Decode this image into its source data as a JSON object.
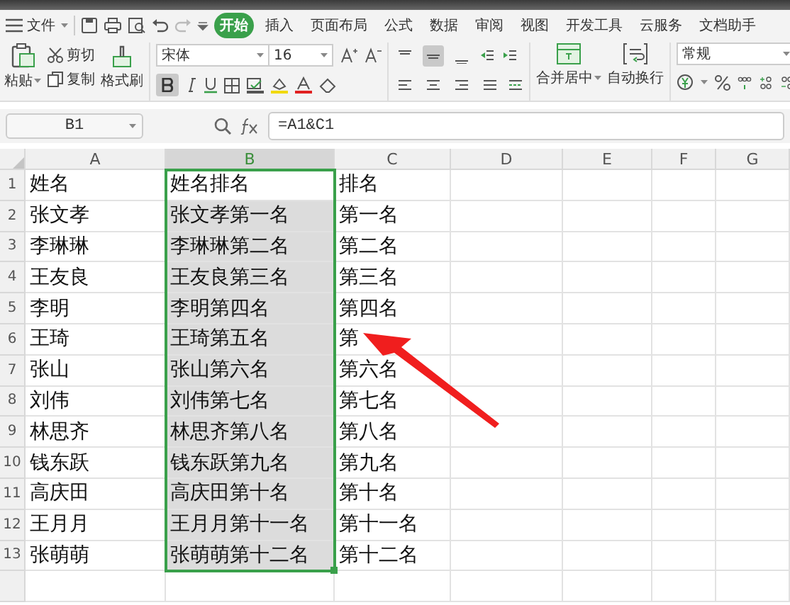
{
  "menu": {
    "file_label": "文件",
    "tabs": [
      {
        "label": "开始",
        "selected": true
      },
      {
        "label": "插入",
        "selected": false
      },
      {
        "label": "页面布局",
        "selected": false
      },
      {
        "label": "公式",
        "selected": false
      },
      {
        "label": "数据",
        "selected": false
      },
      {
        "label": "审阅",
        "selected": false
      },
      {
        "label": "视图",
        "selected": false
      },
      {
        "label": "开发工具",
        "selected": false
      },
      {
        "label": "云服务",
        "selected": false
      },
      {
        "label": "文档助手",
        "selected": false
      }
    ]
  },
  "ribbon": {
    "paste": "粘贴",
    "cut": "剪切",
    "copy": "复制",
    "format_painter": "格式刷",
    "font_name": "宋体",
    "font_size": "16",
    "bold": true,
    "align_middle": true,
    "merge": "合并居中",
    "wrap": "自动换行",
    "number_format": "常规"
  },
  "formula_bar": {
    "cell": "B1",
    "formula": "=A1&C1"
  },
  "sheet": {
    "columns": [
      {
        "label": "A",
        "selected": false
      },
      {
        "label": "B",
        "selected": true
      },
      {
        "label": "C",
        "selected": false
      },
      {
        "label": "D",
        "selected": false
      },
      {
        "label": "E",
        "selected": false
      },
      {
        "label": "F",
        "selected": false
      },
      {
        "label": "G",
        "selected": false
      }
    ],
    "rows": [
      {
        "number": "1",
        "active": true,
        "cells": [
          "姓名",
          "姓名排名",
          "排名"
        ]
      },
      {
        "number": "2",
        "cells": [
          "张文孝",
          "张文孝第一名",
          "第一名"
        ]
      },
      {
        "number": "3",
        "cells": [
          "李琳琳",
          "李琳琳第二名",
          "第二名"
        ]
      },
      {
        "number": "4",
        "cells": [
          "王友良",
          "王友良第三名",
          "第三名"
        ]
      },
      {
        "number": "5",
        "cells": [
          "李明",
          "李明第四名",
          "第四名"
        ]
      },
      {
        "number": "6",
        "cells": [
          "王琦",
          "王琦第五名",
          "第"
        ]
      },
      {
        "number": "7",
        "cells": [
          "张山",
          "张山第六名",
          "第六名"
        ]
      },
      {
        "number": "8",
        "cells": [
          "刘伟",
          "刘伟第七名",
          "第七名"
        ]
      },
      {
        "number": "9",
        "cells": [
          "林思齐",
          "林思齐第八名",
          "第八名"
        ]
      },
      {
        "number": "10",
        "cells": [
          "钱东跃",
          "钱东跃第九名",
          "第九名"
        ]
      },
      {
        "number": "11",
        "cells": [
          "高庆田",
          "高庆田第十名",
          "第十名"
        ]
      },
      {
        "number": "12",
        "cells": [
          "王月月",
          "王月月第十一名",
          "第十一名"
        ]
      },
      {
        "number": "13",
        "cells": [
          "张萌萌",
          "张萌萌第十二名",
          "第十二名"
        ]
      }
    ]
  }
}
